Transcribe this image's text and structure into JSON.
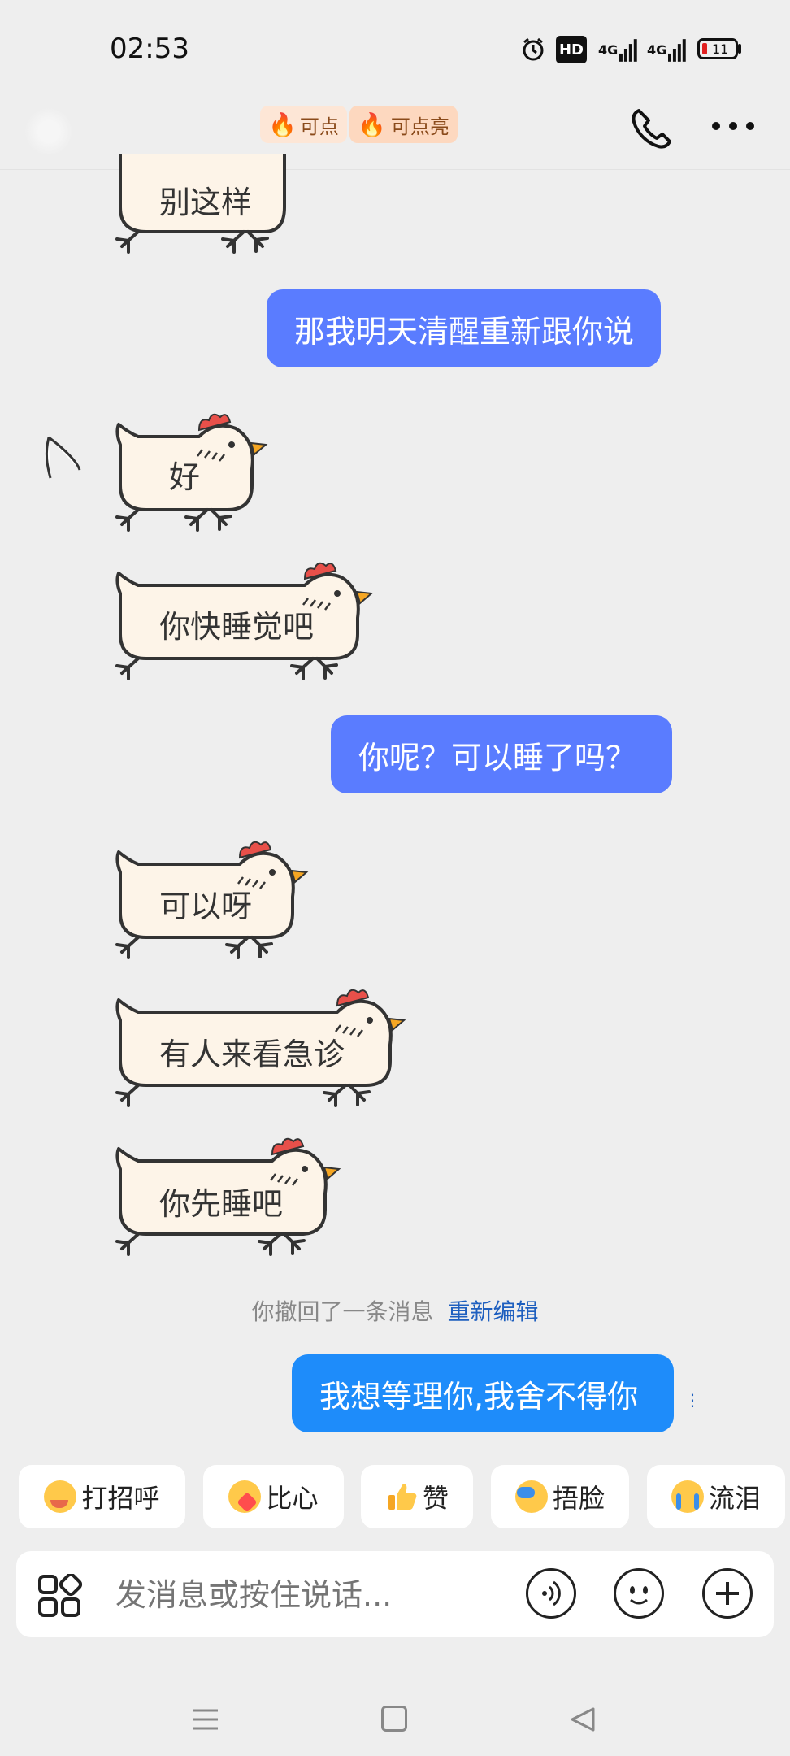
{
  "status_bar": {
    "time": "02:53",
    "battery": "11",
    "signal1": "4G",
    "signal2": "4G",
    "hd": "HD"
  },
  "header": {
    "chip1_label": "可点",
    "chip2_label": "可点亮"
  },
  "messages": [
    {
      "side": "received",
      "text": "别这样"
    },
    {
      "side": "sent",
      "text": "那我明天清醒重新跟你说"
    },
    {
      "side": "received",
      "text": "好"
    },
    {
      "side": "received",
      "text": "你快睡觉吧"
    },
    {
      "side": "sent",
      "text": "你呢？可以睡了吗？"
    },
    {
      "side": "received",
      "text": "可以呀"
    },
    {
      "side": "received",
      "text": "有人来看急诊"
    },
    {
      "side": "received",
      "text": "你先睡吧"
    },
    {
      "side": "sent",
      "text": "我想等理你,我舍不得你"
    }
  ],
  "recall_notice": {
    "text": "你撤回了一条消息",
    "action": "重新编辑"
  },
  "quick_replies": [
    {
      "label": "打招呼",
      "icon": "yawn-emoji-icon"
    },
    {
      "label": "比心",
      "icon": "heart-hands-emoji-icon"
    },
    {
      "label": "赞",
      "icon": "thumbs-up-emoji-icon"
    },
    {
      "label": "捂脸",
      "icon": "facepalm-emoji-icon"
    },
    {
      "label": "流泪",
      "icon": "crying-emoji-icon"
    }
  ],
  "input": {
    "placeholder": "发消息或按住说话..."
  },
  "colors": {
    "sent_bubble": "#5a7cff",
    "last_sent_bubble": "#1e8cfa",
    "link": "#1e5fbf",
    "background": "#eeeeee"
  }
}
